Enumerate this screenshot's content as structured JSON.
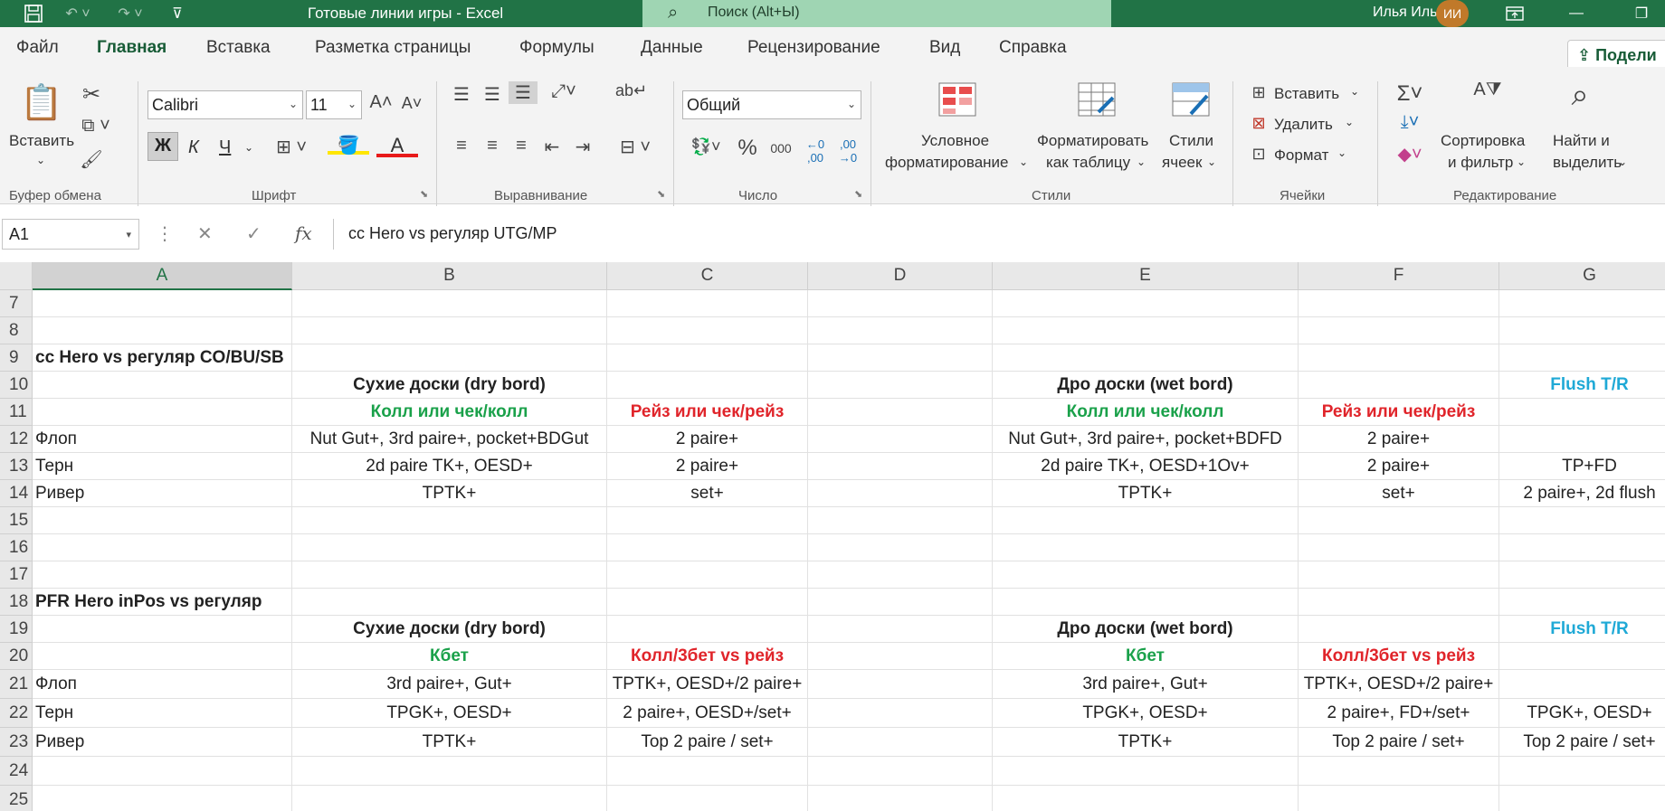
{
  "titlebar": {
    "title": "Готовые линии игры  -  Excel",
    "search_placeholder": "Поиск (Alt+Ы)",
    "user_name": "Илья Илья",
    "user_initials": "ИИ"
  },
  "tabs": [
    "Файл",
    "Главная",
    "Вставка",
    "Разметка страницы",
    "Формулы",
    "Данные",
    "Рецензирование",
    "Вид",
    "Справка"
  ],
  "active_tab": "Главная",
  "share_label": "Подели",
  "ribbon": {
    "clipboard": {
      "paste": "Вставить",
      "label": "Буфер обмена"
    },
    "font": {
      "name": "Calibri",
      "size": "11",
      "bold": "Ж",
      "italic": "К",
      "underline": "Ч",
      "label": "Шрифт"
    },
    "alignment": {
      "label": "Выравнивание"
    },
    "number": {
      "format": "Общий",
      "label": "Число"
    },
    "styles": {
      "conditional_1": "Условное",
      "conditional_2": "форматирование",
      "table_1": "Форматировать",
      "table_2": "как таблицу",
      "cell_1": "Стили",
      "cell_2": "ячеек",
      "label": "Стили"
    },
    "cells": {
      "insert": "Вставить",
      "delete": "Удалить",
      "format": "Формат",
      "label": "Ячейки"
    },
    "editing": {
      "sort_1": "Сортировка",
      "sort_2": "и фильтр",
      "find_1": "Найти и",
      "find_2": "выделить",
      "label": "Редактирование"
    }
  },
  "formula_bar": {
    "name_box": "A1",
    "formula": "cc Hero vs регуляр UTG/MP"
  },
  "sheet": {
    "columns": [
      "A",
      "B",
      "C",
      "D",
      "E",
      "F",
      "G"
    ],
    "selected_column": "A",
    "rows": [
      {
        "n": "7",
        "cells": {}
      },
      {
        "n": "8",
        "cells": {}
      },
      {
        "n": "9",
        "cells": {
          "A": "cc Hero vs регуляр CO/BU/SB"
        }
      },
      {
        "n": "10",
        "cells": {
          "B": "Сухие доски (dry bord)",
          "E": "Дро доски (wet bord)",
          "G": "Flush T/R"
        }
      },
      {
        "n": "11",
        "cells": {
          "B": "Колл или чек/колл",
          "C": "Рейз или чек/рейз",
          "E": "Колл или чек/колл",
          "F": "Рейз или чек/рейз"
        }
      },
      {
        "n": "12",
        "cells": {
          "A": "Флоп",
          "B": "Nut Gut+, 3rd paire+, pocket+BDGut",
          "C": "2 paire+",
          "E": "Nut Gut+, 3rd paire+, pocket+BDFD",
          "F": "2 paire+"
        }
      },
      {
        "n": "13",
        "cells": {
          "A": "Терн",
          "B": "2d paire TK+, OESD+",
          "C": "2 paire+",
          "E": "2d paire TK+, OESD+1Ov+",
          "F": "2 paire+",
          "G": "TP+FD"
        }
      },
      {
        "n": "14",
        "cells": {
          "A": "Ривер",
          "B": "TPTK+",
          "C": "set+",
          "E": "TPTK+",
          "F": "set+",
          "G": "2 paire+, 2d flush"
        }
      },
      {
        "n": "15",
        "cells": {}
      },
      {
        "n": "16",
        "cells": {}
      },
      {
        "n": "17",
        "cells": {}
      },
      {
        "n": "18",
        "cells": {
          "A": "PFR Hero inPos vs регуляр"
        }
      },
      {
        "n": "19",
        "cells": {
          "B": "Сухие доски (dry bord)",
          "E": "Дро доски (wet bord)",
          "G": "Flush T/R"
        }
      },
      {
        "n": "20",
        "cells": {
          "B": "Кбет",
          "C": "Колл/3бет vs рейз",
          "E": "Кбет",
          "F": "Колл/3бет vs рейз"
        }
      },
      {
        "n": "21",
        "cells": {
          "A": "Флоп",
          "B": "3rd paire+, Gut+",
          "C": "TPTK+, OESD+/2 paire+",
          "E": "3rd paire+, Gut+",
          "F": "TPTK+, OESD+/2 paire+"
        }
      },
      {
        "n": "22",
        "cells": {
          "A": "Терн",
          "B": "TPGK+, OESD+",
          "C": "2 paire+, OESD+/set+",
          "E": "TPGK+, OESD+",
          "F": "2 paire+, FD+/set+",
          "G": "TPGK+, OESD+"
        }
      },
      {
        "n": "23",
        "cells": {
          "A": "Ривер",
          "B": "TPTK+",
          "C": "Top 2 paire / set+",
          "E": "TPTK+",
          "F": "Top 2 paire / set+",
          "G": "Top 2 paire / set+"
        }
      },
      {
        "n": "24",
        "cells": {}
      },
      {
        "n": "25",
        "cells": {}
      }
    ]
  },
  "colors": {
    "title_green": "#217346",
    "accent": "#185c37",
    "green_text": "#1aa14a",
    "red_text": "#e0242a",
    "cyan_text": "#1fa9d6"
  }
}
